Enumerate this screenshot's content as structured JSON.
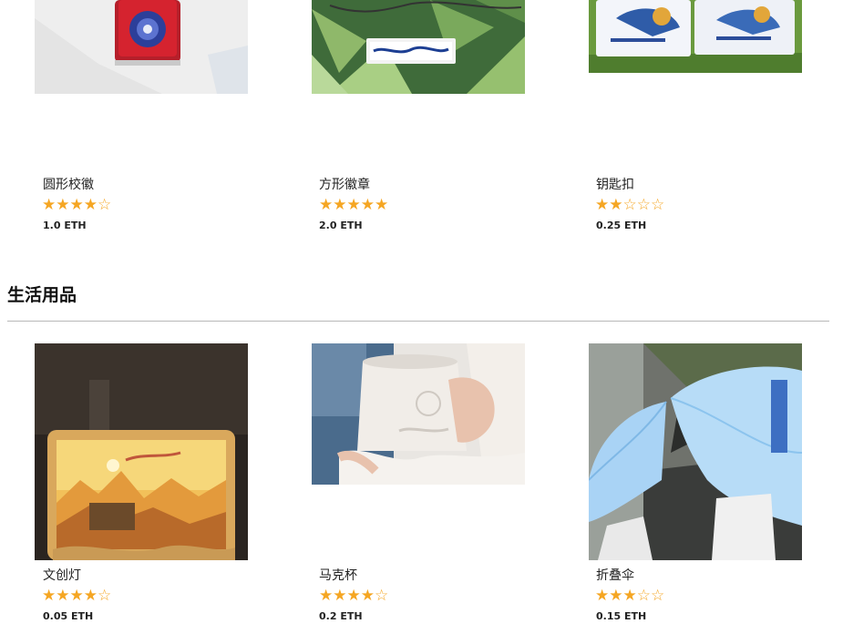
{
  "sections": [
    {
      "title": "",
      "products": [
        {
          "name": "圆形校徽",
          "rating": 4,
          "price": "1.0 ETH",
          "image": "round-badge-photo"
        },
        {
          "name": "方形徽章",
          "rating": 5,
          "price": "2.0 ETH",
          "image": "square-badge-photo"
        },
        {
          "name": "钥匙扣",
          "rating": 2,
          "price": "0.25 ETH",
          "image": "keychain-photo"
        }
      ]
    },
    {
      "title": "生活用品",
      "products": [
        {
          "name": "文创灯",
          "rating": 4,
          "price": "0.05 ETH",
          "image": "lamp-photo"
        },
        {
          "name": "马克杯",
          "rating": 4,
          "price": "0.2 ETH",
          "image": "mug-photo"
        },
        {
          "name": "折叠伞",
          "rating": 3,
          "price": "0.15 ETH",
          "image": "umbrella-photo"
        }
      ]
    }
  ],
  "colors": {
    "star": "#f5a623",
    "divider": "#b8b8b8",
    "text": "#222222"
  }
}
